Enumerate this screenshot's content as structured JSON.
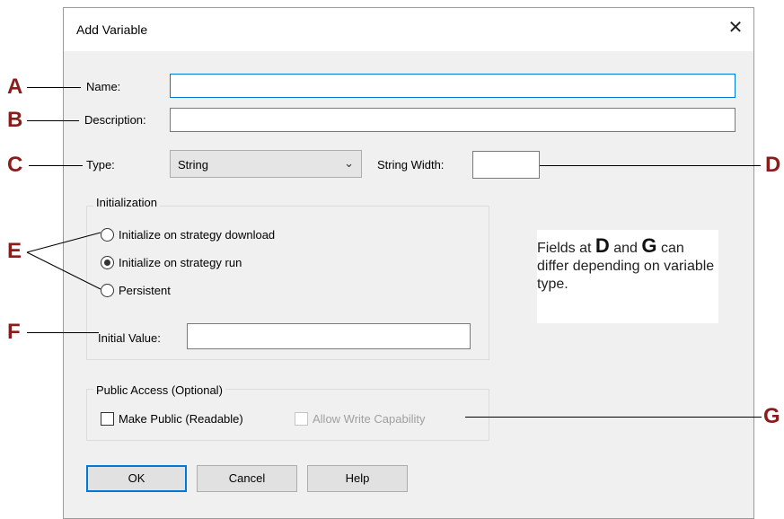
{
  "dialog": {
    "title": "Add Variable",
    "close_glyph": "✕"
  },
  "fields": {
    "name_label": "Name:",
    "name_value": "",
    "description_label": "Description:",
    "description_value": "",
    "type_label": "Type:",
    "type_value": "String",
    "string_width_label": "String Width:",
    "string_width_value": ""
  },
  "initialization": {
    "group_title": "Initialization",
    "options": [
      {
        "label": "Initialize on strategy download",
        "selected": false
      },
      {
        "label": "Initialize on strategy run",
        "selected": true
      },
      {
        "label": "Persistent",
        "selected": false
      }
    ],
    "initial_value_label": "Initial Value:",
    "initial_value": ""
  },
  "public_access": {
    "group_title": "Public Access (Optional)",
    "make_public_label": "Make Public (Readable)",
    "make_public_checked": false,
    "allow_write_label": "Allow Write Capability",
    "allow_write_enabled": false
  },
  "buttons": {
    "ok": "OK",
    "cancel": "Cancel",
    "help": "Help"
  },
  "callouts": {
    "a": "A",
    "b": "B",
    "c": "C",
    "d": "D",
    "e": "E",
    "f": "F",
    "g": "G"
  },
  "note": {
    "text_1": "Fields at ",
    "d": "D",
    "text_2": " and ",
    "g": "G",
    "text_3": " can differ depending on variable type."
  },
  "colors": {
    "callout": "#8b1c1c",
    "focus_border": "#0078d7",
    "dialog_bg": "#f0f0f0"
  }
}
